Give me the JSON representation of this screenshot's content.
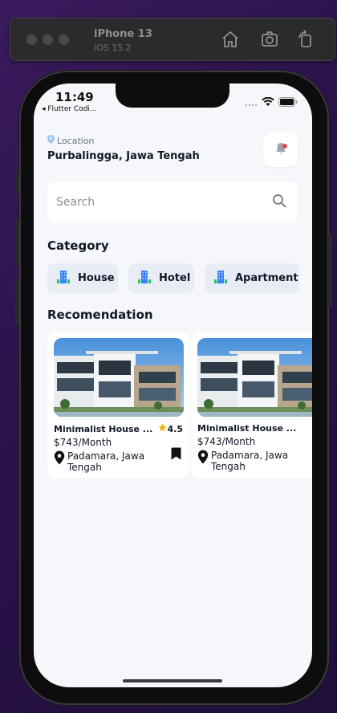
{
  "simulator": {
    "device_name": "iPhone 13",
    "os_version": "iOS 15.2",
    "icons": [
      "home-icon",
      "screenshot-icon",
      "rotate-icon"
    ]
  },
  "status_bar": {
    "time": "11:49",
    "back_label": "◂ Flutter Codi..."
  },
  "header": {
    "location_label": "Location",
    "location_value": "Purbalingga, Jawa Tengah"
  },
  "search": {
    "placeholder": "Search"
  },
  "category": {
    "title": "Category",
    "items": [
      {
        "label": "House",
        "icon": "building-icon"
      },
      {
        "label": "Hotel",
        "icon": "building-icon"
      },
      {
        "label": "Apartment",
        "icon": "building-icon"
      }
    ]
  },
  "recommendation": {
    "title": "Recomendation",
    "cards": [
      {
        "name": "Minimalist House ...",
        "rating": "4.5",
        "price": "$743/Month",
        "location": "Padamara, Jawa Tengah"
      },
      {
        "name": "Minimalist House ...",
        "price": "$743/Month",
        "location": "Padamara, Jawa Tengah"
      }
    ]
  },
  "colors": {
    "accent_dot": "#ef4444",
    "location_pin": "#60a5fa",
    "category_bg": "#e8edf5",
    "star": "#f5b301"
  }
}
